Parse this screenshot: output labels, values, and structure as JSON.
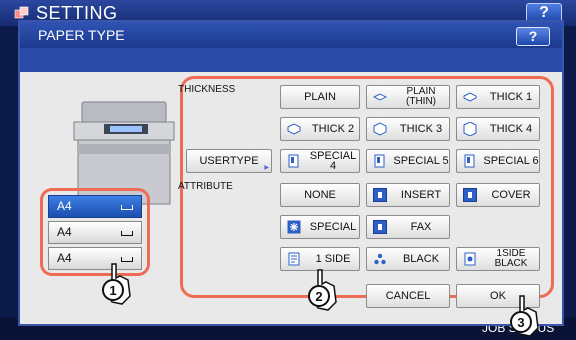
{
  "header": {
    "title": "SETTING",
    "help_label": "?"
  },
  "dialog": {
    "title": "PAPER TYPE",
    "help_label": "?"
  },
  "trays": [
    {
      "label": "A4",
      "selected": true
    },
    {
      "label": "A4",
      "selected": false
    },
    {
      "label": "A4",
      "selected": false
    }
  ],
  "thickness": {
    "label": "THICKNESS",
    "plain": "PLAIN",
    "plain_thin_1": "PLAIN",
    "plain_thin_2": "(THIN)",
    "thick1": "THICK 1",
    "thick2": "THICK 2",
    "thick3": "THICK 3",
    "thick4": "THICK 4",
    "usertype": "USERTYPE",
    "special4": "SPECIAL 4",
    "special5": "SPECIAL 5",
    "special6": "SPECIAL 6"
  },
  "attribute": {
    "label": "ATTRIBUTE",
    "none": "NONE",
    "insert": "INSERT",
    "cover": "COVER",
    "special": "SPECIAL",
    "fax": "FAX",
    "one_side": "1 SIDE",
    "black": "BLACK",
    "one_side_black_1": "1SIDE",
    "one_side_black_2": "BLACK"
  },
  "footer": {
    "cancel": "CANCEL",
    "ok": "OK"
  },
  "status": {
    "job_status": "JOB STATUS"
  },
  "markers": [
    "1",
    "2",
    "3"
  ],
  "colors": {
    "highlight": "#ee6b55",
    "title_blue": "#1c3a8e",
    "selected_tray": "#1b4fae"
  }
}
